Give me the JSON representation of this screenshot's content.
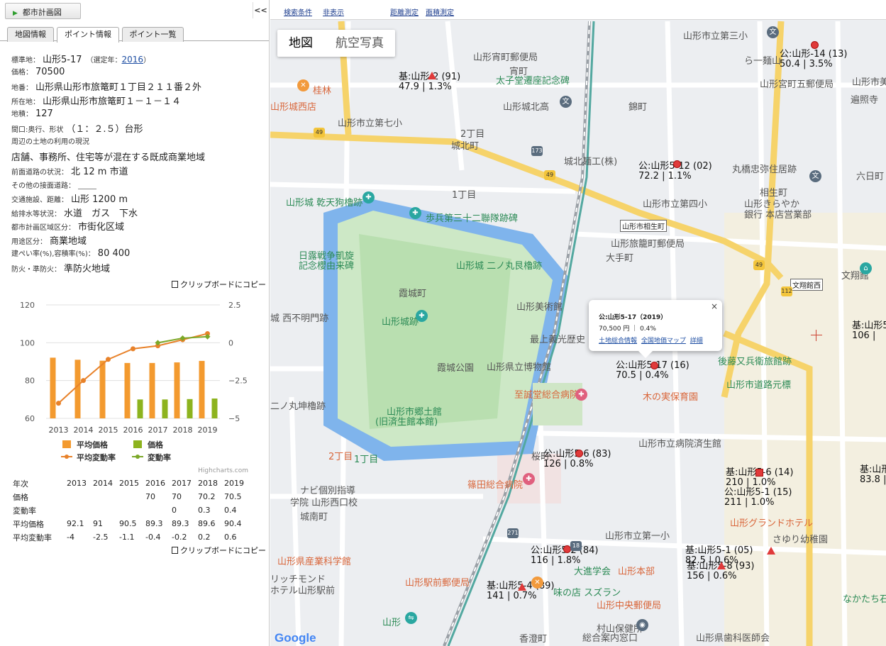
{
  "panel": {
    "title_button": "都市計画図",
    "collapse_label": "<<",
    "tabs": [
      "地図情報",
      "ポイント情報",
      "ポイント一覧"
    ],
    "active_tab": 1,
    "info": {
      "standard_label": "標準地：",
      "standard_value": "山形5-17",
      "year_label": "（選定年：",
      "year_link": "2016",
      "year_close": "）",
      "price_label": "価格：",
      "price_value": "70500",
      "lot_label": "地番：",
      "lot_value": "山形県山形市旅篭町１丁目２１１番２外",
      "address_label": "所在地：",
      "address_value": "山形県山形市旅篭町１－１－１４",
      "area_label": "地積：",
      "area_value": "127",
      "shape_label": "間口:奥行、形状",
      "shape_value": "（１：２.５）台形",
      "surround_label": "周辺の土地の利用の現況",
      "surround_value": "店舗、事務所、住宅等が混在する既成商業地域",
      "road_label": "前面道路の状況：",
      "road_value": "北 12 m 市道",
      "other_road_label": "その他の接面道路：",
      "other_road_value": "＿＿",
      "transit_label": "交通施設、距離：",
      "transit_value": "山形 1200 m",
      "utilities_label": "給排水等状況：",
      "utilities_value": "水道　ガス　下水",
      "cityplan_label": "都市計画区域区分：",
      "cityplan_value": "市街化区域",
      "zoning_label": "用途区分：",
      "zoning_value": "商業地域",
      "coverage_label": "建ぺい率(%),容積率(%)：",
      "coverage_value": "80 400",
      "fire_label": "防火・準防火：",
      "fire_value": "準防火地域"
    },
    "copy_label": "クリップボードにコピー",
    "credits": "Highcharts.com",
    "stats_table": {
      "header": [
        "年次",
        "2013",
        "2014",
        "2015",
        "2016",
        "2017",
        "2018",
        "2019"
      ],
      "rows": [
        [
          "価格",
          "",
          "",
          "",
          "70",
          "70",
          "70.2",
          "70.5"
        ],
        [
          "変動率",
          "",
          "",
          "",
          "",
          "0",
          "0.3",
          "0.4"
        ],
        [
          "平均価格",
          "92.1",
          "91",
          "90.5",
          "89.3",
          "89.3",
          "89.6",
          "90.4"
        ],
        [
          "平均変動率",
          "-4",
          "-2.5",
          "-1.1",
          "-0.4",
          "-0.2",
          "0.2",
          "0.6"
        ]
      ]
    }
  },
  "chart_data": {
    "type": "bar",
    "categories": [
      "2013",
      "2014",
      "2015",
      "2016",
      "2017",
      "2018",
      "2019"
    ],
    "series": [
      {
        "name": "平均価格",
        "kind": "bar",
        "axis": "left",
        "color": "#f39a2f",
        "values": [
          92.1,
          91,
          90.5,
          89.3,
          89.3,
          89.6,
          90.4
        ]
      },
      {
        "name": "価格",
        "kind": "bar",
        "axis": "left",
        "color": "#8db31e",
        "values": [
          null,
          null,
          null,
          70,
          70,
          70.2,
          70.5
        ]
      },
      {
        "name": "平均変動率",
        "kind": "line",
        "axis": "right",
        "color": "#e8822a",
        "values": [
          -4,
          -2.5,
          -1.1,
          -0.4,
          -0.2,
          0.2,
          0.6
        ]
      },
      {
        "name": "変動率",
        "kind": "line",
        "axis": "right",
        "color": "#7ba828",
        "values": [
          null,
          null,
          null,
          null,
          0,
          0.3,
          0.4
        ]
      }
    ],
    "y_left": {
      "ticks": [
        "120",
        "100",
        "80",
        "60"
      ],
      "range": [
        60,
        120
      ]
    },
    "y_right": {
      "ticks": [
        "2.5",
        "0",
        "−2.5",
        "−5"
      ],
      "range": [
        -5,
        2.5
      ]
    },
    "legend_placement": "bottom",
    "grid": true
  },
  "map": {
    "toolbar": [
      "検索条件",
      "非表示",
      "距離測定",
      "面積測定"
    ],
    "map_types": [
      "地図",
      "航空写真"
    ],
    "popup": {
      "title": "公:山形5-17（2019）",
      "line": "70,500 円 ｜ 0.4%",
      "links": [
        "土地総合情報",
        "全国地価マップ",
        "詳細"
      ],
      "close": "×"
    },
    "markers": [
      {
        "name": "基:山形-2 (91)",
        "sub": "47.9 | 1.3%",
        "shape": "tri"
      },
      {
        "name": "公:山形-14 (13)",
        "sub": "50.4 | 3.5%",
        "shape": "dot"
      },
      {
        "name": "公:山形5-12 (02)",
        "sub": "72.2 | 1.1%",
        "shape": "dot"
      },
      {
        "name": "公:山形5-17 (16)",
        "sub": "70.5 | 0.4%",
        "shape": "dot"
      },
      {
        "name": "基:山形5-6 (14)",
        "sub": "210 | 1.0%",
        "shape": "sq"
      },
      {
        "name": "公:山形5-1 (15)",
        "sub": "211 | 1.0%",
        "shape": "none"
      },
      {
        "name": "公:山形5-6 (83)",
        "sub": "126 | 0.8%",
        "shape": "dot"
      },
      {
        "name": "公:山形5-2 (84)",
        "sub": "116 | 1.8%",
        "shape": "dot"
      },
      {
        "name": "基:山形5-1 (05)",
        "sub": "82.5 | 0.6%",
        "shape": "tri"
      },
      {
        "name": "基:山形5-8 (93)",
        "sub": "156 | 0.6%",
        "shape": "tri"
      },
      {
        "name": "基:山形5-4 (89)",
        "sub": "141 | 0.7%",
        "shape": "tri"
      },
      {
        "name": "基:山形5",
        "sub": "83.8 |",
        "shape": "none"
      },
      {
        "name": "基:山形5",
        "sub": "106 |",
        "shape": "none"
      }
    ],
    "places": [
      "山形市立第三小",
      "ら一麺山",
      "山形宵町郵便局",
      "宵町",
      "太子堂遷座記念碑",
      "山形市美容",
      "山形宮町五郵便局",
      "遍照寺",
      "桂林",
      "山形城西店",
      "山形城北高",
      "錦町",
      "山形市立第七小",
      "2丁目",
      "城北町",
      "城北麺工(株)",
      "丸橋忠弥住居跡",
      "六日町",
      "山形城 乾天狗櫓跡",
      "1丁目",
      "山形市立第四小",
      "相生町",
      "山形きらやか",
      "銀行 本店営業部",
      "山形市相生町",
      "歩兵第三十二聯隊跡碑",
      "日露戦争凱旋",
      "記念櫻由来碑",
      "山形城 二ノ丸艮櫓跡",
      "山形旅籠町郵便局",
      "大手町",
      "文翔館",
      "霞城町",
      "文翔館西",
      "山形美術館",
      "城 西不明門跡",
      "山形城跡",
      "霞城公園",
      "山形県立博物館",
      "最上義光歴史",
      "後藤又兵衛旅館跡",
      "山形市道路元標",
      "二ノ丸坤櫓跡",
      "1丁目",
      "山形市郷土館",
      "(旧済生館本館)",
      "至誠堂総合病院",
      "木の実保育園",
      "山形市立病院済生館",
      "2丁目",
      "桜町",
      "篠田総合病院",
      "ナビ個別指導",
      "学院 山形西口校",
      "城南町",
      "山形グランドホテル",
      "山形市立第一小",
      "さゆり幼稚園",
      "山形県産業科学館",
      "リッチモンド",
      "ホテル山形駅前",
      "山形駅前郵便局",
      "山形本部",
      "味の店 スズラン",
      "山形中央郵便局",
      "大進学会",
      "なかたち石",
      "山形",
      "村山保健所",
      "総合案内窓口",
      "香澄町",
      "山形県歯科医師会"
    ],
    "logo": "Google"
  }
}
